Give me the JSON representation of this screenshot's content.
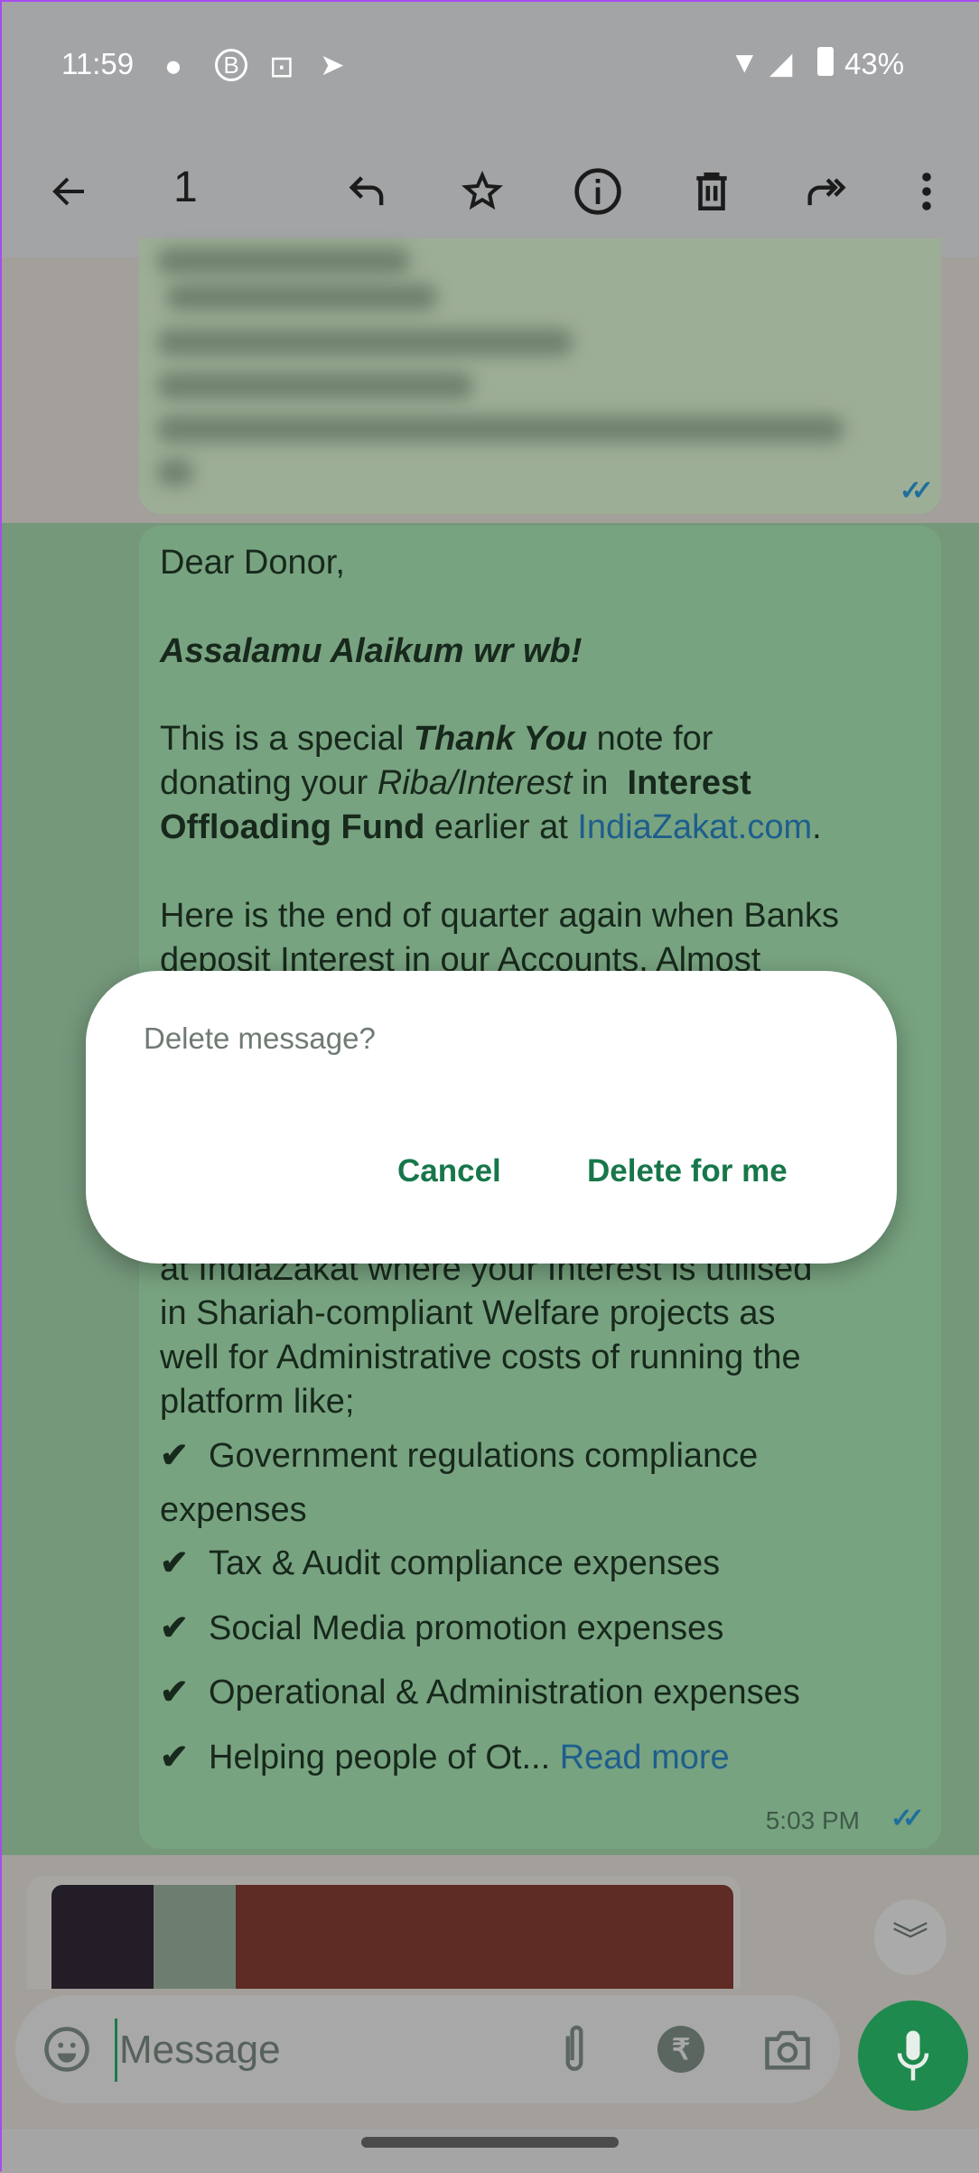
{
  "status_bar": {
    "time": "11:59",
    "battery": "43%",
    "icons": [
      "chat-bubble-icon",
      "business-b-icon",
      "scan-icon",
      "telegram-icon",
      "wifi-icon",
      "signal-icon",
      "battery-icon"
    ]
  },
  "toolbar": {
    "selected_count": "1",
    "icons": [
      "back-arrow-icon",
      "reply-icon",
      "star-icon",
      "info-icon",
      "delete-icon",
      "forward-icon",
      "more-vert-icon"
    ]
  },
  "message": {
    "greeting": "Dear Donor,",
    "salam": "Assalamu Alaikum wr wb!",
    "p1_a": "This is a special ",
    "p1_b": "Thank You",
    "p1_c": " note for",
    "p2_a": "donating your ",
    "p2_b": "Riba/Interest",
    "p2_c": " in  ",
    "p2_d": "Interest",
    "p3_a": "Offloading Fund",
    "p3_b": " earlier at ",
    "p3_link": "IndiaZakat.com",
    "p3_c": ".",
    "p4": "Here is the end of quarter again when Banks",
    "p5": "deposit Interest in our Accounts. Almost",
    "p6": "at IndiaZakat where your Interest is utilised",
    "p7": "in Shariah-compliant Welfare projects as",
    "p8": "well for Administrative costs of running the",
    "p9": "platform like;",
    "bullets": [
      "Government regulations compliance",
      "Tax & Audit compliance expenses",
      "Social Media promotion expenses",
      "Operational & Administration expenses",
      "Helping people of Ot..."
    ],
    "bullet_continuation": "expenses",
    "check_glyph": "✔",
    "read_more": "Read more",
    "time": "5:03 PM",
    "ticks": "✓✓"
  },
  "dialog": {
    "title": "Delete message?",
    "cancel": "Cancel",
    "delete": "Delete for me"
  },
  "composer": {
    "placeholder": "Message"
  },
  "colors": {
    "accent": "#1e8a4d",
    "dialog_button": "#17774a",
    "link": "#1d5e8c",
    "read_ticks": "#1f6f9c"
  }
}
